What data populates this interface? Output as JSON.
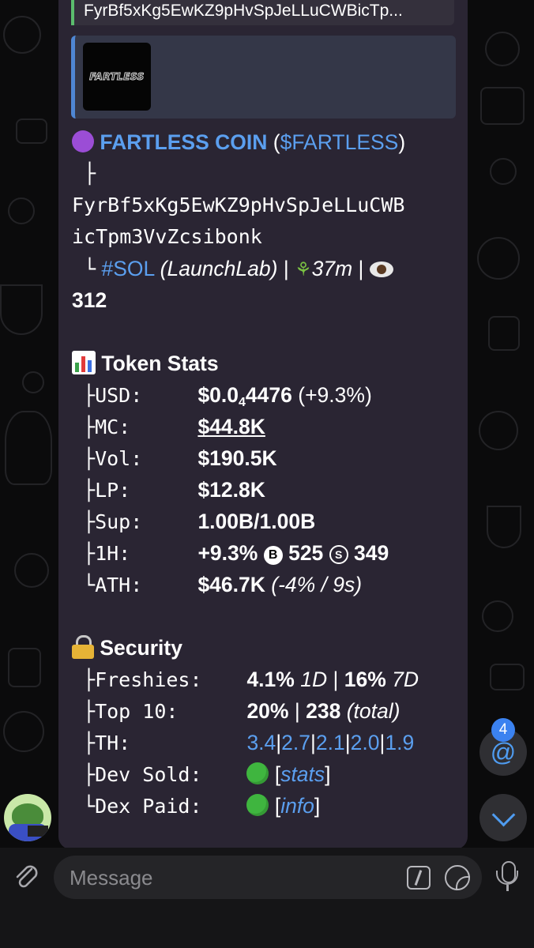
{
  "previous_message": {
    "contract_preview": "FyrBf5xKg5EwKZ9pHvSpJeLLuCWBicTp..."
  },
  "reply_preview": {
    "thumbnail_text": "FARTLESS"
  },
  "token": {
    "name": "FARTLESS COIN",
    "ticker_open": "(",
    "ticker": "$FARTLESS",
    "ticker_close": ")",
    "address_line1": "FyrBf5xKg5EwKZ9pHvSpJeLLuCWB",
    "address_line2": "icTpm3VvZcsibonk",
    "chain_tag": "#SOL",
    "launchpad": "(LaunchLab)",
    "separator": "|",
    "age": "37m",
    "views": "312"
  },
  "token_stats": {
    "heading": "Token Stats",
    "rows": [
      {
        "tree": "├",
        "label": "USD:",
        "value_main": "$0.0",
        "value_sub": "4",
        "value_rest": "4476",
        "value_extra": "(+9.3%)"
      },
      {
        "tree": "├",
        "label": "MC:",
        "value": "$44.8K"
      },
      {
        "tree": "├",
        "label": "Vol:",
        "value": "$190.5K"
      },
      {
        "tree": "├",
        "label": "LP:",
        "value": "$12.8K"
      },
      {
        "tree": "├",
        "label": "Sup:",
        "value": "1.00B/1.00B"
      },
      {
        "tree": "├",
        "label": "1H:",
        "value": "+9.3%",
        "buy_icon": "B",
        "buys": "525",
        "sell_icon": "S",
        "sells": "349"
      },
      {
        "tree": "└",
        "label": "ATH:",
        "value": "$46.7K",
        "value_extra": "(-4% / 9s)"
      }
    ]
  },
  "security": {
    "heading": "Security",
    "rows": [
      {
        "tree": "├",
        "label": "Freshies:",
        "v1": "4.1%",
        "v1_note": "1D",
        "sep": "|",
        "v2": "16%",
        "v2_note": "7D"
      },
      {
        "tree": "├",
        "label": "Top 10:",
        "v1": "20%",
        "sep": "|",
        "v2": "238",
        "v2_note": "(total)"
      },
      {
        "tree": "├",
        "label": "TH:",
        "holders": [
          "3.4",
          "2.7",
          "2.1",
          "2.0",
          "1.9"
        ],
        "sep": "|"
      },
      {
        "tree": "├",
        "label": "Dev Sold:",
        "status": "green",
        "link_open": "[",
        "link": "stats",
        "link_close": "]"
      },
      {
        "tree": "└",
        "label": "Dex Paid:",
        "status": "green",
        "link_open": "[",
        "link": "info",
        "link_close": "]"
      }
    ]
  },
  "mentions": {
    "count": "4",
    "symbol": "@"
  },
  "composer": {
    "placeholder": "Message"
  },
  "colors": {
    "bubble": "#2a2533",
    "link": "#5b9fef",
    "accent": "#3b82f0",
    "status_green": "#3fb53f"
  }
}
